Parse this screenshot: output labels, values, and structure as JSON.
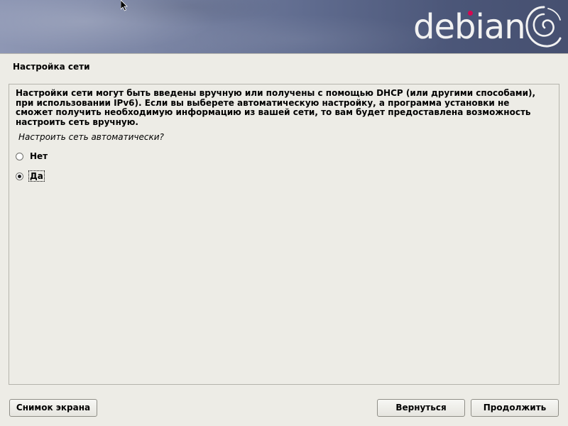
{
  "banner": {
    "brand": "debian",
    "brand_dot_color": "#d70751",
    "logo_icon": "debian-swirl-icon"
  },
  "page": {
    "title": "Настройка сети"
  },
  "content": {
    "description_lines": [
      "Настройки сети могут быть введены вручную или получены с помощью DHCP (или другими способами),",
      "при использовании IPv6). Если вы выберете автоматическую настройку, а программа установки не",
      "сможет получить необходимую информацию из вашей сети, то вам будет предоставлена возможность",
      "настроить сеть вручную."
    ],
    "question": "Настроить сеть автоматически?",
    "options": [
      {
        "label": "Нет",
        "selected": false
      },
      {
        "label": "Да",
        "selected": true
      }
    ]
  },
  "buttons": {
    "screenshot": "Снимок экрана",
    "back": "Вернуться",
    "continue": "Продолжить"
  }
}
